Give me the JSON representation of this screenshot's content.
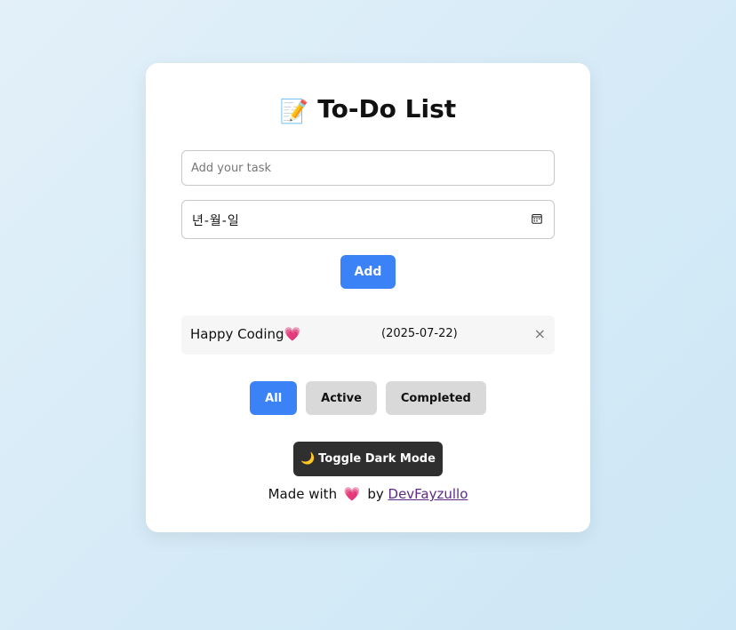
{
  "header": {
    "title_icon": "📝",
    "title": "To-Do List"
  },
  "form": {
    "task_placeholder": "Add your task",
    "task_value": "",
    "date_placeholder": "년-월-일",
    "add_label": "Add"
  },
  "tasks": [
    {
      "text": "Happy Coding💗",
      "date": "(2025-07-22)",
      "delete_label": "×"
    }
  ],
  "filters": {
    "all_label": "All",
    "active_label": "Active",
    "completed_label": "Completed",
    "selected": "All"
  },
  "dark_mode": {
    "icon": "🌙",
    "label": "Toggle Dark Mode"
  },
  "footer": {
    "prefix": "Made with",
    "heart": "💗",
    "by": "by",
    "author": "DevFayzullo"
  },
  "colors": {
    "accent": "#3b82f6",
    "dark_button": "#2f2f2f",
    "inactive_filter": "#d9d9d9"
  }
}
